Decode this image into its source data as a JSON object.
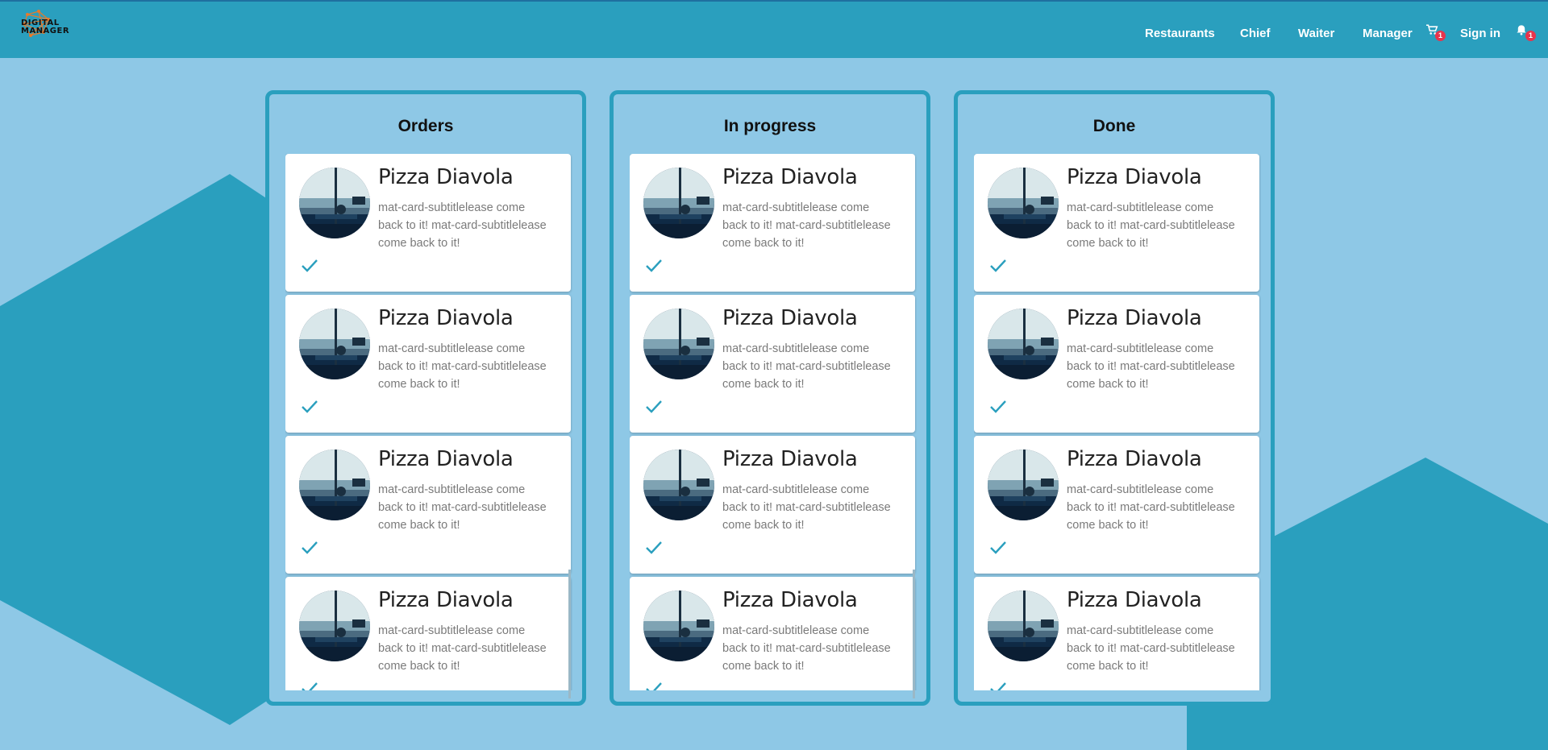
{
  "brand": {
    "line1": "DIGITAL",
    "line2": "MANAGER"
  },
  "nav": {
    "items": [
      "Restaurants",
      "Chief",
      "Waiter",
      "Manager"
    ],
    "cart_badge": "1",
    "signin": "Sign in",
    "notif_badge": "1"
  },
  "columns": [
    {
      "title": "Orders"
    },
    {
      "title": "In progress"
    },
    {
      "title": "Done"
    }
  ],
  "card": {
    "title": "Pizza Diavola",
    "subtitle": "mat-card-subtitlelease come back to it! mat-card-subtitlelease come back to it!"
  },
  "colors": {
    "header": "#2a9fbe",
    "background": "#8ec8e6",
    "accent": "#2a9fbe",
    "badge": "#e8344c"
  }
}
